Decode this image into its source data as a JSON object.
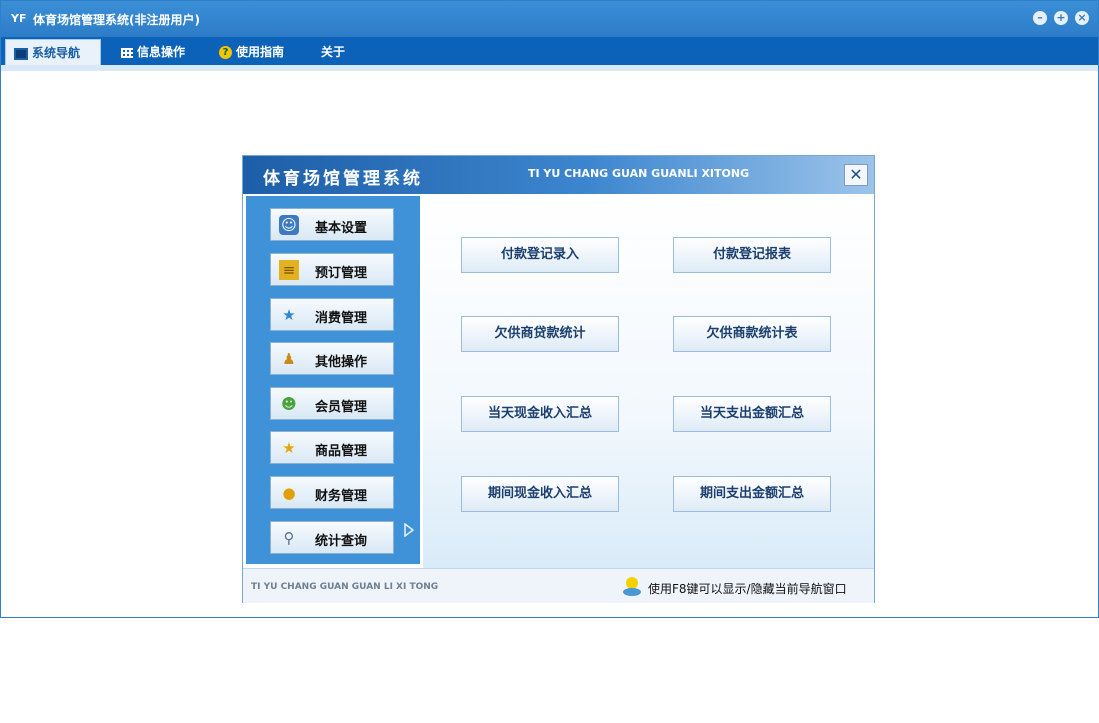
{
  "window": {
    "title": "体育场馆管理系统(非注册用户)",
    "app_icon": "yf-logo-icon",
    "controls": [
      "minimize-icon",
      "restore-icon",
      "close-icon"
    ]
  },
  "tabs": [
    {
      "label": "系统导航",
      "icon": "monitor-icon",
      "active": true
    },
    {
      "label": "信息操作",
      "icon": "grid-icon",
      "active": false
    },
    {
      "label": "使用指南",
      "icon": "help-icon",
      "active": false
    },
    {
      "label": "关于",
      "icon": "",
      "active": false
    }
  ],
  "dialog": {
    "title": "体育场馆管理系统",
    "pinyin_title": "TI YU CHANG GUAN GUANLI XITONG",
    "close_label": "✕",
    "nav": [
      {
        "label": "基本设置",
        "icon": "id-card-icon"
      },
      {
        "label": "预订管理",
        "icon": "notebook-icon"
      },
      {
        "label": "消费管理",
        "icon": "star-icon"
      },
      {
        "label": "其他操作",
        "icon": "person-icon"
      },
      {
        "label": "会员管理",
        "icon": "users-icon"
      },
      {
        "label": "商品管理",
        "icon": "gold-star-icon"
      },
      {
        "label": "财务管理",
        "icon": "coins-icon"
      },
      {
        "label": "统计查询",
        "icon": "magnifier-icon"
      }
    ],
    "functions": [
      "付款登记录入",
      "付款登记报表",
      "欠供商贷款统计",
      "欠供商款统计表",
      "当天现金收入汇总",
      "当天支出金额汇总",
      "期间现金收入汇总",
      "期间支出金额汇总"
    ],
    "footer_pinyin": "TI YU CHANG GUAN GUAN LI XI TONG",
    "hint": "使用F8键可以显示/隐藏当前导航窗口"
  },
  "colors": {
    "title_bar": "#2d7cc7",
    "tab_bar": "#0b62b8",
    "sidebar": "#3f91d8"
  }
}
